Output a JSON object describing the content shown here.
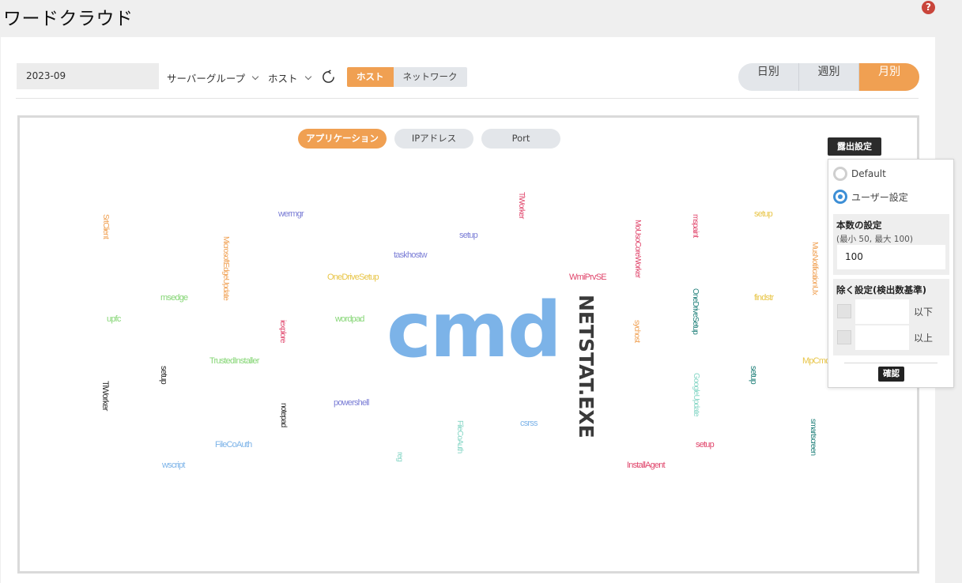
{
  "page": {
    "title": "ワードクラウド",
    "help_icon": "question-circle-icon"
  },
  "toolbar": {
    "date_value": "2023-09",
    "server_group": "サーバーグループ",
    "host_dropdown": "ホスト",
    "refresh_icon": "refresh-icon",
    "scope_tabs": [
      {
        "label": "ホスト",
        "active": true
      },
      {
        "label": "ネットワーク",
        "active": false
      }
    ],
    "period_tabs": [
      {
        "label": "日別",
        "active": false
      },
      {
        "label": "週別",
        "active": false
      },
      {
        "label": "月別",
        "active": true
      }
    ]
  },
  "cloud_tabs": [
    {
      "label": "アプリケーション",
      "active": true
    },
    {
      "label": "IPアドレス",
      "active": false
    },
    {
      "label": "Port",
      "active": false
    }
  ],
  "words": [
    {
      "text": "cmd",
      "color": "#7cb3e8"
    },
    {
      "text": "NETSTAT.EXE",
      "color": "#3a3a3a"
    },
    {
      "text": "SrtClient",
      "color": "#f0a052"
    },
    {
      "text": "wermgr",
      "color": "#7b7ed6"
    },
    {
      "text": "TiWorker",
      "color": "#e0456b"
    },
    {
      "text": "setup",
      "color": "#7b7ed6"
    },
    {
      "text": "MoUsoCoreWorker",
      "color": "#e0456b"
    },
    {
      "text": "mspaint",
      "color": "#e0456b"
    },
    {
      "text": "setup",
      "color": "#e8c547"
    },
    {
      "text": "MicrosoftEdgeUpdate",
      "color": "#f0a052"
    },
    {
      "text": "taskhostw",
      "color": "#7b7ed6"
    },
    {
      "text": "MusNotificationUx",
      "color": "#f0a052"
    },
    {
      "text": "OneDriveSetup",
      "color": "#e8c547"
    },
    {
      "text": "WmiPrvSE",
      "color": "#e0456b"
    },
    {
      "text": "msedge",
      "color": "#86d676"
    },
    {
      "text": "OneDriveSetup",
      "color": "#20807a"
    },
    {
      "text": "findstr",
      "color": "#e8c547"
    },
    {
      "text": "upfc",
      "color": "#86d676"
    },
    {
      "text": "iexplore",
      "color": "#e0456b"
    },
    {
      "text": "wordpad",
      "color": "#86d676"
    },
    {
      "text": "sychost",
      "color": "#f0a052"
    },
    {
      "text": "TrustedInstaller",
      "color": "#86d676"
    },
    {
      "text": "MpCmd",
      "color": "#e8c547"
    },
    {
      "text": "setup",
      "color": "#2b2b2b"
    },
    {
      "text": "setup",
      "color": "#20807a"
    },
    {
      "text": "GoogleUpdate",
      "color": "#86d6c6"
    },
    {
      "text": "TiWorker",
      "color": "#2b2b2b"
    },
    {
      "text": "powershell",
      "color": "#7b7ed6"
    },
    {
      "text": "notepad",
      "color": "#2b2b2b"
    },
    {
      "text": "FileCoAuth",
      "color": "#86d6c6"
    },
    {
      "text": "csrss",
      "color": "#7cb3e8"
    },
    {
      "text": "smartscreen",
      "color": "#20807a"
    },
    {
      "text": "FileCoAuth",
      "color": "#7cb3e8"
    },
    {
      "text": "setup",
      "color": "#e0456b"
    },
    {
      "text": "reg",
      "color": "#86d6c6"
    },
    {
      "text": "wscript",
      "color": "#7cb3e8"
    },
    {
      "text": "InstallAgent",
      "color": "#e0456b"
    }
  ],
  "settings": {
    "tab_label": "露出設定",
    "radio_default": "Default",
    "radio_user": "ユーザー設定",
    "selected": "user",
    "count_title": "本数の設定",
    "count_sub": "(最小 50, 最大 100)",
    "count_value": "100",
    "exclude_title": "除く設定(検出数基準)",
    "below_label": "以下",
    "above_label": "以上",
    "confirm_label": "確認"
  }
}
